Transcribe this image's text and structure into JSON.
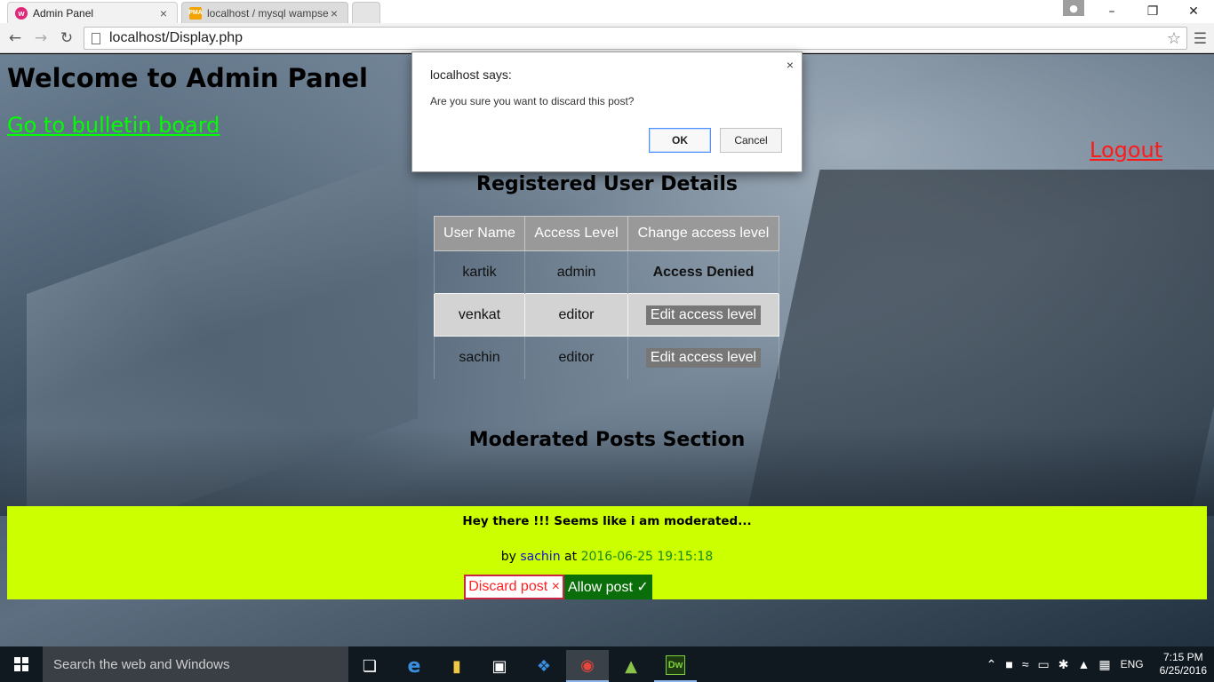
{
  "browser": {
    "tabs": [
      {
        "title": "Admin Panel",
        "favicon": "wamp-icon",
        "active": true
      },
      {
        "title": "localhost / mysql wampse",
        "favicon": "phpmyadmin-icon",
        "active": false
      }
    ],
    "favicon_labels": {
      "wamp": "w",
      "pma": "PMA"
    },
    "url": "localhost/Display.php"
  },
  "page": {
    "welcome_heading": "Welcome to Admin Panel",
    "bulletin_link": "Go to bulletin board",
    "logout_link": "Logout",
    "registered_title": "Registered User Details",
    "users_table": {
      "headers": [
        "User Name",
        "Access Level",
        "Change access level"
      ],
      "rows": [
        {
          "user": "kartik",
          "access": "admin",
          "change": "Access Denied"
        },
        {
          "user": "venkat",
          "access": "editor",
          "change": "Edit access level"
        },
        {
          "user": "sachin",
          "access": "editor",
          "change": "Edit access level"
        }
      ]
    },
    "moderated_title": "Moderated Posts Section",
    "post": {
      "text": "Hey there !!! Seems like i am moderated...",
      "by_label": "by",
      "author": "sachin",
      "at_label": "at",
      "date": "2016-06-25 19:15:18",
      "discard_label": "Discard post ×",
      "allow_label": "Allow post ✓"
    }
  },
  "dialog": {
    "title": "localhost says:",
    "message": "Are you sure you want to discard this post?",
    "ok_label": "OK",
    "cancel_label": "Cancel",
    "close_glyph": "×"
  },
  "taskbar": {
    "search_placeholder": "Search the web and Windows",
    "language": "ENG",
    "time": "7:15 PM",
    "date": "6/25/2016",
    "apps": [
      "task-view-icon",
      "edge-icon",
      "file-explorer-icon",
      "store-icon",
      "dropbox-icon",
      "chrome-icon",
      "android-studio-icon",
      "dreamweaver-icon"
    ],
    "dreamweaver_label": "Dw"
  },
  "colors": {
    "accent_link_green": "#00ff00",
    "logout_red": "#ff1a1a",
    "post_background": "#ccff00",
    "allow_green": "#0a6e0a",
    "table_header": "#999999"
  }
}
